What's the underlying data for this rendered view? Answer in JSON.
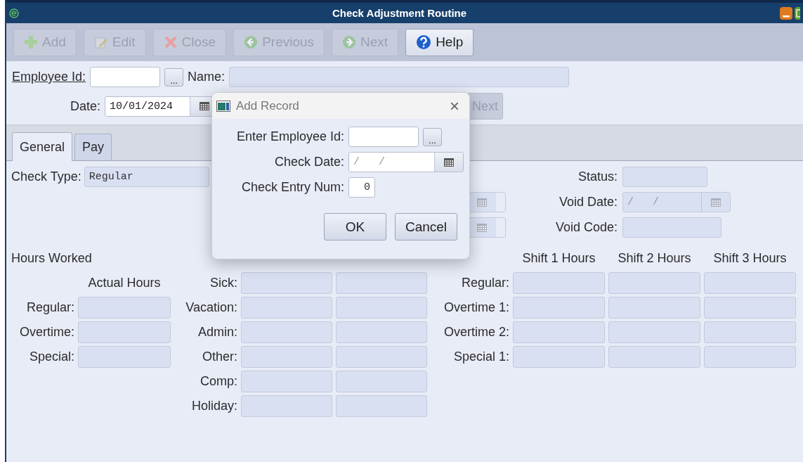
{
  "window": {
    "title": "Check Adjustment Routine"
  },
  "toolbar": [
    {
      "label": "Add",
      "disabled": true
    },
    {
      "label": "Edit",
      "disabled": true
    },
    {
      "label": "Close",
      "disabled": true
    },
    {
      "label": "Previous",
      "disabled": true
    },
    {
      "label": "Next",
      "disabled": true
    },
    {
      "label": "Help",
      "disabled": false
    }
  ],
  "header": {
    "employee_id": {
      "label": "Employee Id:",
      "lookup": "...",
      "disabled": false
    },
    "name": {
      "label": "Name:",
      "disabled": true
    },
    "date": {
      "label": "Date:",
      "value": "10/01/2024",
      "disabled": false
    },
    "next_button": {
      "label": "Next",
      "disabled": true
    }
  },
  "tabs": [
    {
      "label": "General",
      "selected": true
    },
    {
      "label": "Pay",
      "selected": false
    }
  ],
  "general": {
    "check_type": {
      "label": "Check Type:",
      "value": "Regular",
      "disabled": true
    },
    "status": {
      "label": "Status:",
      "disabled": true
    },
    "void_date": {
      "label": "Void Date:",
      "placeholder": "/   /",
      "disabled": true
    },
    "void_code": {
      "label": "Void Code:",
      "disabled": true
    },
    "hours": {
      "title": "Hours Worked",
      "actual": {
        "header": "Actual Hours",
        "rows": [
          "Regular:",
          "Overtime:",
          "Special:"
        ]
      },
      "leave": {
        "rows": [
          "Sick:",
          "Vacation:",
          "Admin:",
          "Other:",
          "Comp:",
          "Holiday:"
        ]
      },
      "shifts": {
        "headers": [
          "Shift 1 Hours",
          "Shift 2 Hours",
          "Shift 3 Hours"
        ],
        "rows": [
          "Regular:",
          "Overtime 1:",
          "Overtime 2:",
          "Special 1:"
        ]
      }
    }
  },
  "dialog": {
    "title": "Add Record",
    "close": "×",
    "employee_id": {
      "label": "Enter Employee Id:",
      "lookup": "..."
    },
    "check_date": {
      "label": "Check Date:",
      "placeholder": "/   /"
    },
    "entry_num": {
      "label": "Check Entry Num:",
      "value": "0"
    },
    "buttons": [
      "OK",
      "Cancel"
    ]
  }
}
